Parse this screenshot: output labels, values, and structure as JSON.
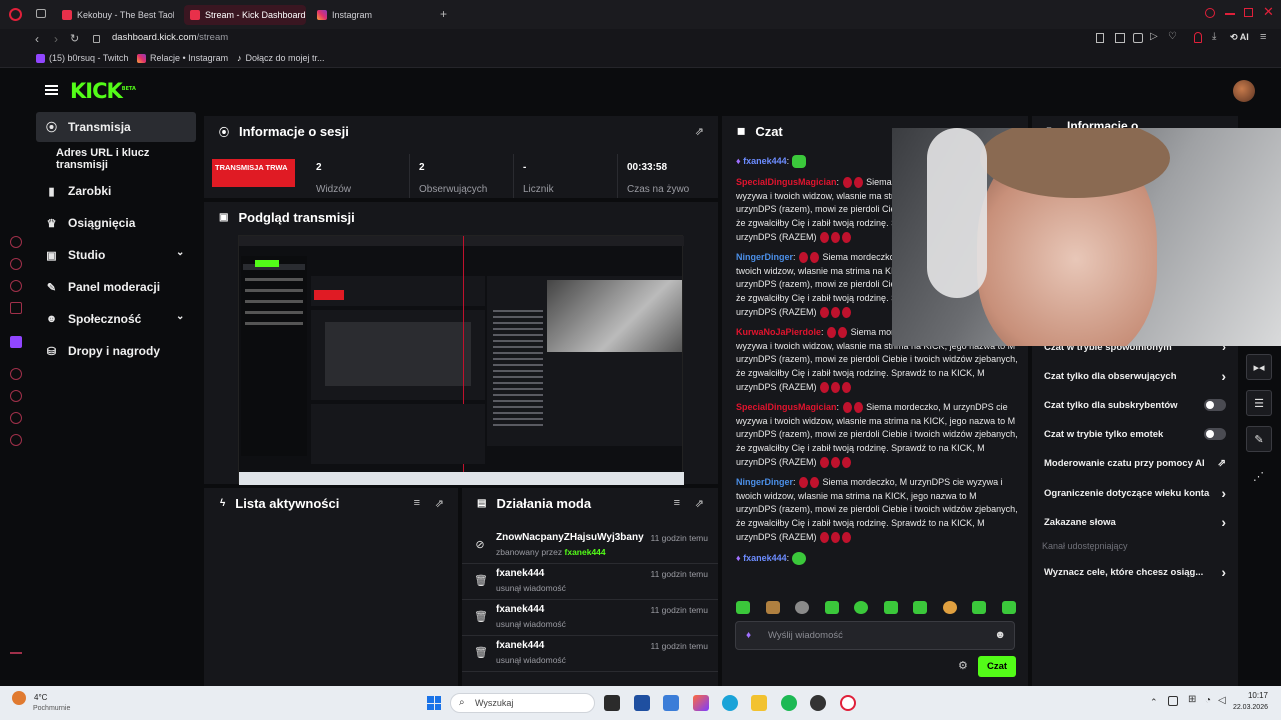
{
  "browser": {
    "tabs": [
      {
        "label": "Kekobuy - The Best Taob",
        "color": "#e8304a"
      },
      {
        "label": "Stream - Kick Dashboard",
        "color": "#e8304a"
      },
      {
        "label": "Instagram",
        "color": "#e1306c"
      }
    ],
    "url_domain": "dashboard.kick.com",
    "url_path": "/stream",
    "ai_label": "AI",
    "bookmarks": [
      {
        "label": "(15) b0rsuq - Twitch"
      },
      {
        "label": "Relacje • Instagram"
      },
      {
        "label": "Dołącz do mojej tr..."
      }
    ]
  },
  "kick": {
    "logo": "KICK",
    "logo_sup": "BETA",
    "nav": [
      {
        "label": "Transmisja",
        "icon": "broadcast-icon",
        "glyph": "⟨·⟩"
      },
      {
        "label": "Adres URL i klucz transmisji",
        "icon": "",
        "glyph": ""
      },
      {
        "label": "Zarobki",
        "icon": "chart-icon",
        "glyph": "▮"
      },
      {
        "label": "Osiągnięcia",
        "icon": "trophy-icon",
        "glyph": "🏆"
      },
      {
        "label": "Studio",
        "icon": "studio-icon",
        "glyph": "▣"
      },
      {
        "label": "Panel moderacji",
        "icon": "wrench-icon",
        "glyph": "🔧"
      },
      {
        "label": "Społeczność",
        "icon": "users-icon",
        "glyph": "👥"
      },
      {
        "label": "Dropy i nagrody",
        "icon": "gift-icon",
        "glyph": "⛁"
      }
    ],
    "session": {
      "title": "Informacje o sesji",
      "live_badge": "TRANSMISJA TRWA",
      "stats": [
        {
          "value": "2",
          "label": "Widzów"
        },
        {
          "value": "2",
          "label": "Obserwujących"
        },
        {
          "value": "-",
          "label": "Licznik"
        },
        {
          "value": "00:33:58",
          "label": "Czas na żywo"
        }
      ]
    },
    "preview": {
      "title": "Podgląd transmisji"
    },
    "activity": {
      "title": "Lista aktywności"
    },
    "modactions": {
      "title": "Działania moda",
      "rows": [
        {
          "name": "ZnowNacpanyZHajsuWyj3bany",
          "sub_prefix": "zbanowany przez ",
          "sub_user": "fxanek444",
          "time": "11 godzin temu",
          "icon": "ban-icon",
          "glyph": "⊘"
        },
        {
          "name": "fxanek444",
          "sub_prefix": "usunął wiadomość",
          "sub_user": "",
          "time": "11 godzin temu",
          "icon": "trash-icon",
          "glyph": "🗑"
        },
        {
          "name": "fxanek444",
          "sub_prefix": "usunął wiadomość",
          "sub_user": "",
          "time": "11 godzin temu",
          "icon": "trash-icon",
          "glyph": "🗑"
        },
        {
          "name": "fxanek444",
          "sub_prefix": "usunął wiadomość",
          "sub_user": "",
          "time": "11 godzin temu",
          "icon": "trash-icon",
          "glyph": "🗑"
        }
      ]
    },
    "chat": {
      "title": "Czat",
      "messages": [
        {
          "user": "fxanek444",
          "color": "#a070ff",
          "text": ""
        },
        {
          "user": "SpecialDingusMagician",
          "color": "#e0142e",
          "text": "Siema mordeczko, M urzynDPS cie wyzywa i twoich widzow, wlasnie ma strima na KICK, jego nazwa to M urzynDPS (razem), mowi ze pierdoli Ciebie i twoich widzów zjebanych, że zgwalciłby Cię i zabił twoją rodzinę. Sprawdź to na KICK, M urzynDPS (RAZEM)"
        },
        {
          "user": "NingerDinger",
          "color": "#4b8fe8",
          "text": "Siema mordeczko, M urzynDPS cie wyzywa i twoich widzow, wlasnie ma strima na KICK, jego nazwa to M urzynDPS (razem), mowi ze pierdoli Ciebie i twoich widzów zjebanych, że zgwalciłby Cię i zabił twoją rodzinę. Sprawdź to na KICK, M urzynDPS (RAZEM)"
        },
        {
          "user": "KurwaNoJaPierdole",
          "color": "#e0142e",
          "text": "Siema mordeczko, M urzynDPS cie wyzywa i twoich widzow, wlasnie ma strima na KICK, jego nazwa to M urzynDPS (razem), mowi ze pierdoli Ciebie i twoich widzów zjebanych, że zgwalciłby Cię i zabił twoją rodzinę. Sprawdź to na KICK, M urzynDPS (RAZEM)"
        },
        {
          "user": "SpecialDingusMagician",
          "color": "#e0142e",
          "text": "Siema mordeczko, M urzynDPS cie wyzywa i twoich widzow, wlasnie ma strima na KICK, jego nazwa to M urzynDPS (razem), mowi ze pierdoli Ciebie i twoich widzów zjebanych, że zgwalciłby Cię i zabił twoją rodzinę. Sprawdź to na KICK, M urzynDPS (RAZEM)"
        },
        {
          "user": "NingerDinger",
          "color": "#4b8fe8",
          "text": "Siema mordeczko, M urzynDPS cie wyzywa i twoich widzow, wlasnie ma strima na KICK, jego nazwa to M urzynDPS (razem), mowi ze pierdoli Ciebie i twoich widzów zjebanych, że zgwalciłby Cię i zabił twoją rodzinę. Sprawdź to na KICK, M urzynDPS (RAZEM)"
        },
        {
          "user": "fxanek444",
          "color": "#a070ff",
          "text": ""
        }
      ],
      "input_placeholder": "Wyślij wiadomość",
      "send_label": "Czat"
    },
    "info": {
      "title": "Informacje o",
      "settings": [
        {
          "label": "Czat w trybie spowolnionym",
          "control": "chevron"
        },
        {
          "label": "Czat tylko dla obserwujących",
          "control": "chevron"
        },
        {
          "label": "Czat tylko dla subskrybentów",
          "control": "toggle"
        },
        {
          "label": "Czat w trybie tylko emotek",
          "control": "toggle"
        },
        {
          "label": "Moderowanie czatu przy pomocy AI",
          "control": "external"
        },
        {
          "label": "Ograniczenie dotyczące wieku konta",
          "control": "chevron"
        },
        {
          "label": "Zakazane słowa",
          "control": "chevron"
        }
      ],
      "section_label": "Kanał udostępniający",
      "goal_label": "Wyznacz cele, które chcesz osiąg..."
    }
  },
  "taskbar": {
    "weather_temp": "4°C",
    "weather_desc": "Pochmurnie",
    "search_placeholder": "Wyszukaj",
    "time": "10:17",
    "date": "22.03.2026"
  },
  "colors": {
    "kick_green": "#53fc18",
    "live_red": "#e01b24",
    "panel": "#16171b"
  }
}
